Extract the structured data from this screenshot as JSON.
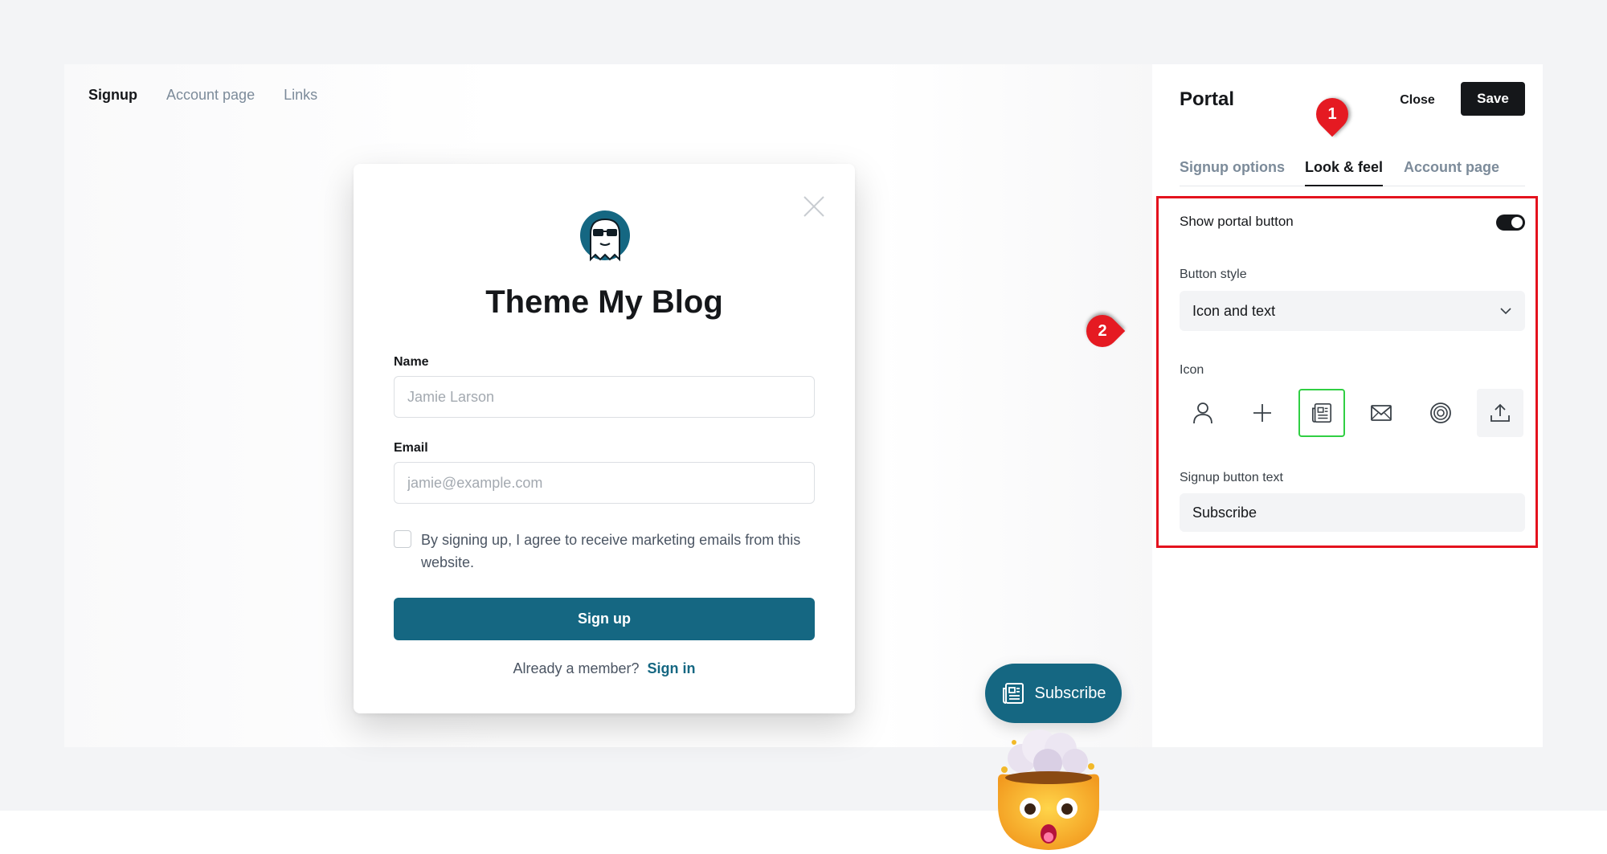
{
  "preview": {
    "tabs": [
      {
        "label": "Signup",
        "active": true
      },
      {
        "label": "Account page",
        "active": false
      },
      {
        "label": "Links",
        "active": false
      }
    ],
    "modal": {
      "site_title": "Theme My Blog",
      "name_label": "Name",
      "name_placeholder": "Jamie Larson",
      "email_label": "Email",
      "email_placeholder": "jamie@example.com",
      "consent_text": "By signing up, I agree to receive marketing emails from this website.",
      "signup_button": "Sign up",
      "member_text": "Already a member?",
      "signin_link": "Sign in"
    },
    "floating_button": {
      "label": "Subscribe",
      "icon": "newspaper-icon"
    }
  },
  "panel": {
    "title": "Portal",
    "close_label": "Close",
    "save_label": "Save",
    "tabs": [
      {
        "label": "Signup options",
        "active": false
      },
      {
        "label": "Look & feel",
        "active": true
      },
      {
        "label": "Account page",
        "active": false
      }
    ],
    "show_portal_button": {
      "label": "Show portal button",
      "enabled": true
    },
    "button_style": {
      "label": "Button style",
      "value": "Icon and text"
    },
    "icon": {
      "label": "Icon",
      "options": [
        "user-icon",
        "plus-icon",
        "newspaper-icon",
        "envelope-icon",
        "at-sign-icon",
        "upload-icon"
      ],
      "selected": "newspaper-icon"
    },
    "signup_button_text": {
      "label": "Signup button text",
      "value": "Subscribe"
    }
  },
  "annotations": {
    "markers": [
      "1",
      "2"
    ],
    "highlight_color": "#e4121e"
  },
  "colors": {
    "brand": "#156782",
    "accent_selected": "#30cf43",
    "marker_red": "#e51a22"
  }
}
